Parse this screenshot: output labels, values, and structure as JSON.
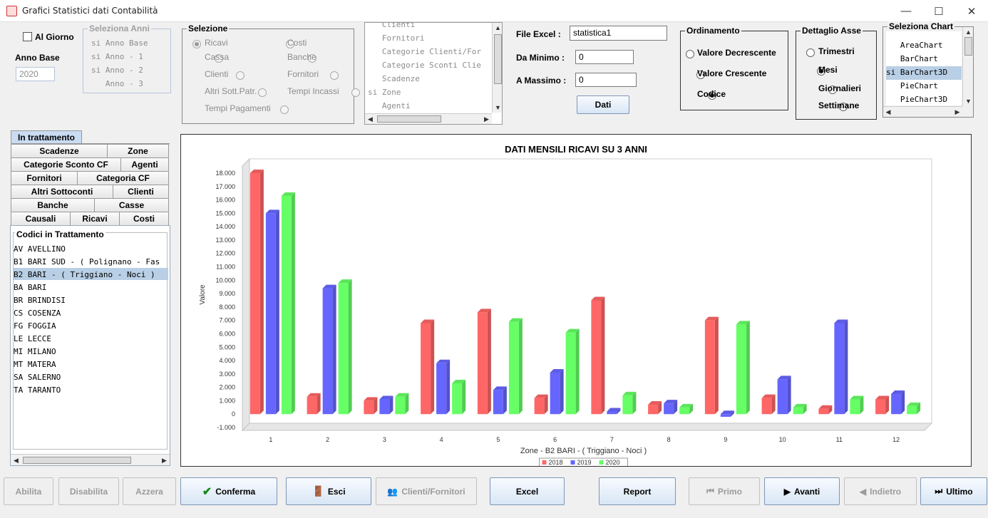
{
  "window": {
    "title": "Grafici Statistici dati Contabilità",
    "min": "—",
    "max": "☐",
    "close": "✕"
  },
  "top_left": {
    "al_giorno": "Al Giorno",
    "anno_base_label": "Anno Base",
    "anno_base_value": "2020"
  },
  "seleziona_anni": {
    "legend": "Seleziona Anni",
    "items": [
      "si Anno Base",
      "si Anno - 1",
      "si Anno - 2",
      "   Anno - 3"
    ]
  },
  "selezione": {
    "legend": "Selezione",
    "options": [
      "Ricavi",
      "Costi",
      "Cassa",
      "Banche",
      "Clienti",
      "Fornitori",
      "Altri Sott.Patr.",
      "Tempi Incassi",
      "Tempi Pagamenti"
    ],
    "selected": "Ricavi"
  },
  "categorie_list": {
    "items": [
      "   Clienti",
      "   Fornitori",
      "   Categorie Clienti/For",
      "   Categorie Sconti Clie",
      "   Scadenze",
      "si Zone",
      "   Agenti"
    ]
  },
  "file_excel": {
    "label": "File Excel :",
    "value": "statistica1",
    "da_minimo_label": "Da Minimo :",
    "da_minimo_value": "0",
    "a_massimo_label": "A Massimo :",
    "a_massimo_value": "0",
    "dati_button": "Dati"
  },
  "ordinamento": {
    "legend": "Ordinamento",
    "options": [
      "Valore Decrescente",
      "Valore Crescente",
      "Codice"
    ],
    "selected": "Codice"
  },
  "dettaglio_asse": {
    "legend": "Dettaglio Asse",
    "options": [
      "Trimestri",
      "Mesi",
      "Giornalieri",
      "Settimane"
    ],
    "selected": "Mesi"
  },
  "seleziona_chart": {
    "legend": "Seleziona Chart",
    "items": [
      "   AreaChart",
      "   BarChart",
      "si BarChart3D",
      "   PieChart",
      "   PieChart3D"
    ],
    "selected": "si BarChart3D"
  },
  "tabs": {
    "active": "In trattamento",
    "rows": [
      [
        "Scadenze",
        "Zone"
      ],
      [
        "Categorie Sconto CF",
        "Agenti"
      ],
      [
        "Fornitori",
        "Categoria CF"
      ],
      [
        "Altri Sottoconti",
        "Clienti"
      ],
      [
        "Banche",
        "Casse"
      ],
      [
        "Causali",
        "Ricavi",
        "Costi"
      ]
    ]
  },
  "codici": {
    "legend": "Codici in Trattamento",
    "items": [
      "AV AVELLINO",
      "B1 BARI SUD - ( Polignano - Fas",
      "B2 BARI - ( Triggiano - Noci )",
      "BA BARI",
      "BR BRINDISI",
      "CS COSENZA",
      "FG FOGGIA",
      "LE LECCE",
      "MI MILANO",
      "MT MATERA",
      "SA SALERNO",
      "TA TARANTO"
    ],
    "selected": "B2 BARI - ( Triggiano - Noci )"
  },
  "colors": {
    "s2018": "#ff6666",
    "s2019": "#6666ff",
    "s2020": "#66ff66",
    "selection": "#b8cfe5"
  },
  "chart_data": {
    "type": "bar",
    "title": "DATI MENSILI RICAVI SU 3 ANNI",
    "xlabel": "Zone - B2 BARI - ( Triggiano - Noci )",
    "ylabel": "Valore",
    "ylim": [
      -1000,
      18000
    ],
    "yticks": [
      "-1.000",
      "0",
      "1.000",
      "2.000",
      "3.000",
      "4.000",
      "5.000",
      "6.000",
      "7.000",
      "8.000",
      "9.000",
      "10.000",
      "11.000",
      "12.000",
      "13.000",
      "14.000",
      "15.000",
      "16.000",
      "17.000",
      "18.000"
    ],
    "categories": [
      "1",
      "2",
      "3",
      "4",
      "5",
      "6",
      "7",
      "8",
      "9",
      "10",
      "11",
      "12"
    ],
    "series": [
      {
        "name": "2018",
        "values": [
          18000,
          1300,
          1000,
          6800,
          7600,
          1200,
          8500,
          700,
          7000,
          1200,
          400,
          1100
        ]
      },
      {
        "name": "2019",
        "values": [
          15000,
          9400,
          1100,
          3800,
          1800,
          3100,
          200,
          800,
          -200,
          2600,
          6800,
          1500
        ]
      },
      {
        "name": "2020",
        "values": [
          16300,
          9800,
          1300,
          2300,
          6900,
          6100,
          1400,
          500,
          6700,
          500,
          1100,
          600
        ]
      }
    ],
    "legend_position": "bottom"
  },
  "buttons": {
    "abilita": "Abilita",
    "disabilita": "Disabilita",
    "azzera": "Azzera",
    "conferma": "Conferma",
    "esci": "Esci",
    "clienti_fornitori": "Clienti/Fornitori",
    "excel": "Excel",
    "report": "Report",
    "primo": "Primo",
    "avanti": "Avanti",
    "indietro": "Indietro",
    "ultimo": "Ultimo"
  }
}
